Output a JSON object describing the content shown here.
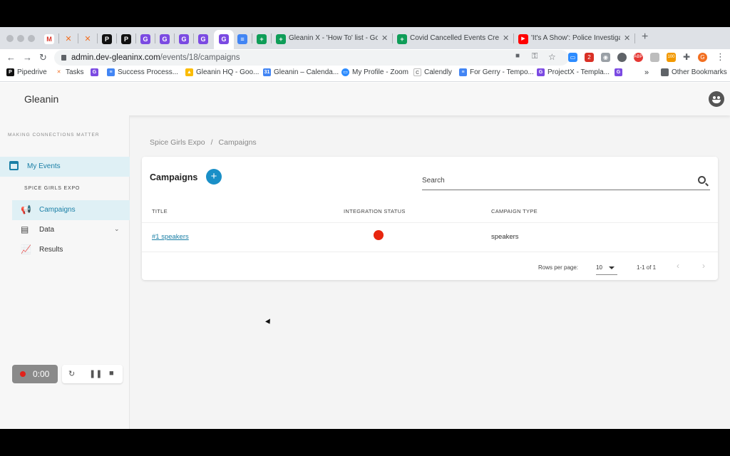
{
  "browser": {
    "tabs": [
      {
        "title": "Gleanin X - 'How To' list - Goo"
      },
      {
        "title": "Covid Cancelled Events Credit"
      },
      {
        "title": "'It's A Show': Police Investigati"
      }
    ],
    "new_tab": "+",
    "url_host": "admin.dev-gleaninx.com",
    "url_path": "/events/18/campaigns",
    "bookmarks": [
      "Pipedrive",
      "Tasks",
      "Success Process...",
      "Gleanin HQ - Goo...",
      "Gleanin – Calenda...",
      "My Profile - Zoom",
      "Calendly",
      "For Gerry - Tempo...",
      "ProjectX - Templa..."
    ],
    "more": "»",
    "other_bookmarks": "Other Bookmarks"
  },
  "app": {
    "brand": "Gleanin",
    "tagline": "MAKING CONNECTIONS MATTER",
    "nav": {
      "my_events": "My Events",
      "event_name": "SPICE GIRLS EXPO",
      "campaigns": "Campaigns",
      "data": "Data",
      "results": "Results"
    },
    "recorder": {
      "time": "0:00"
    },
    "breadcrumb": {
      "parent": "Spice Girls Expo",
      "sep": "/",
      "current": "Campaigns"
    },
    "card": {
      "title": "Campaigns",
      "add": "+",
      "search_placeholder": "Search",
      "columns": [
        "TITLE",
        "INTEGRATION STATUS",
        "CAMPAIGN TYPE"
      ],
      "rows": [
        {
          "title": "#1 speakers",
          "status_color": "#e8260f",
          "type": "speakers"
        }
      ],
      "pagination": {
        "rows_per_page_label": "Rows per page:",
        "rows_per_page": "10",
        "range": "1-1 of 1",
        "prev": "‹",
        "next": "›"
      }
    }
  },
  "colors": {
    "accent": "#1a8fc7",
    "status_error": "#e8260f",
    "nav_active_bg": "#dff0f5"
  }
}
